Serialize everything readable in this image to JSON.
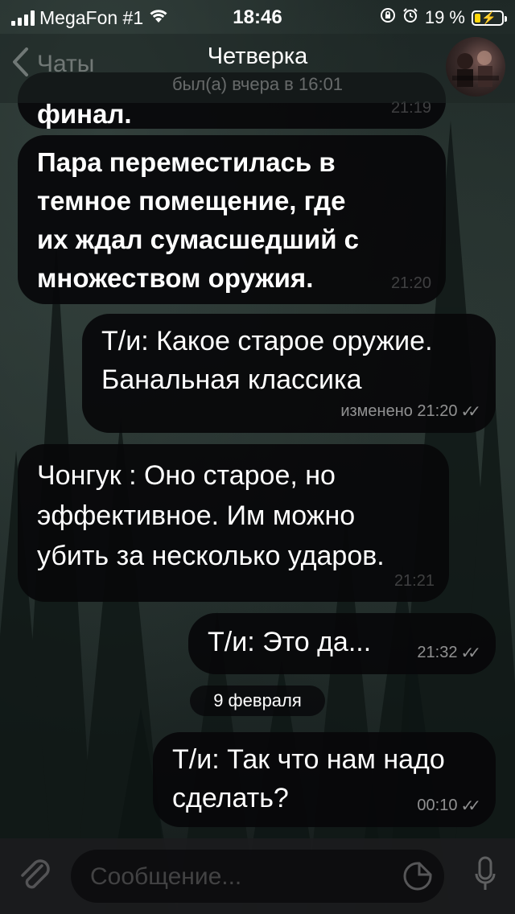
{
  "status_bar": {
    "carrier": "MegaFon #1",
    "time": "18:46",
    "battery_percent": "19 %"
  },
  "header": {
    "back_label": "Чаты",
    "title": "Четверка",
    "subtitle": "был(а) вчера в 16:01"
  },
  "messages": [
    {
      "side": "in",
      "text": "финал.",
      "time": "21:19"
    },
    {
      "side": "in",
      "text": "Пара переместилась в\nтемное помещение, где\nих ждал сумасшедший с\nмножеством оружия.",
      "time": "21:20"
    },
    {
      "side": "out",
      "text": "Т/и: Какое старое оружие.\nБанальная классика",
      "time": "изменено 21:20",
      "read": true
    },
    {
      "side": "in",
      "text": "Чонгук : Оно старое, но\nэффективное. Им можно\nубить за несколько ударов.",
      "time": "21:21"
    },
    {
      "side": "out",
      "text": "Т/и: Это да...",
      "time": "21:32",
      "read": true
    },
    {
      "side": "out",
      "text": "Т/и: Так что нам надо\nсделать?",
      "time": "00:10",
      "read": true
    }
  ],
  "date_separator": "9 февраля",
  "input": {
    "placeholder": "Сообщение..."
  },
  "icons": {
    "back": "chevron-left-icon",
    "attach": "paperclip-icon",
    "sticker": "sticker-icon",
    "mic": "microphone-icon",
    "read": "double-check-icon"
  },
  "colors": {
    "bubble": "#08080a",
    "battery_fill": "#ffd60a",
    "text": "#ffffff"
  }
}
